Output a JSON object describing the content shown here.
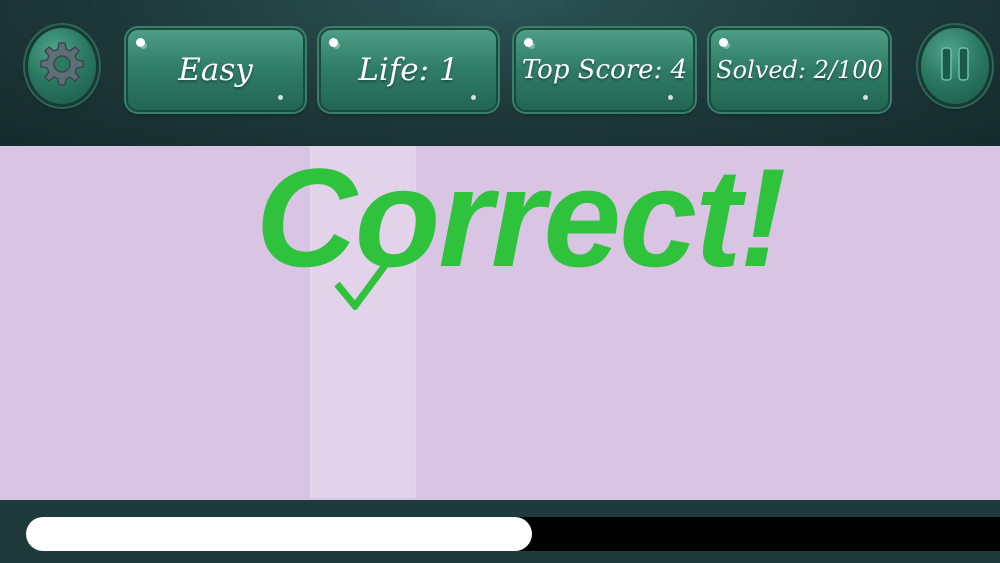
{
  "hud": {
    "settings_icon": "gear-icon",
    "pause_icon": "pause-icon",
    "difficulty": "Easy",
    "life": "Life: 1",
    "top_score": "Top Score: 4",
    "solved": "Solved: 2/100"
  },
  "feedback": {
    "message": "Correct!",
    "icon": "check-mark-icon",
    "color": "#2ec23d"
  },
  "progress": {
    "fraction": 0.52
  },
  "colors": {
    "play_area": "#d9c4e4",
    "hud_button": "#2f7c64",
    "background": "#1f3a3b"
  }
}
